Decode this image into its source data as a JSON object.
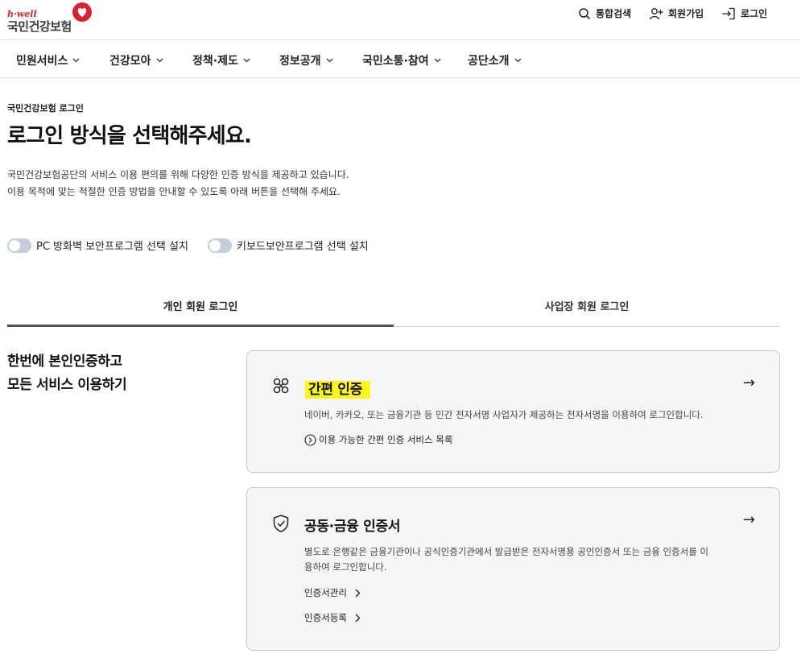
{
  "logo": {
    "brand": "h·well",
    "name": "국민건강보험"
  },
  "utilities": {
    "search": "통합검색",
    "join": "회원가입",
    "login": "로그인"
  },
  "nav": [
    "민원서비스",
    "건강모아",
    "정책·제도",
    "정보공개",
    "국민소통·참여",
    "공단소개"
  ],
  "intro": {
    "eyebrow": "국민건강보험 로그인",
    "title": "로그인 방식을 선택해주세요.",
    "desc_line1": "국민건강보험공단의 서비스 이용 편의를 위해 다양한 인증 방식을 제공하고 있습니다.",
    "desc_line2": "이용 목적에 맞는 적절한 인증 방법을 안내할 수 있도록 아래 버튼을 선택해 주세요."
  },
  "toggles": [
    "PC 방화벽 보안프로그램 선택 설치",
    "키보드보안프로그램 선택 설치"
  ],
  "tabs": {
    "personal": "개인 회원 로그인",
    "business": "사업장 회원 로그인"
  },
  "side_heading": {
    "line1": "한번에 본인인증하고",
    "line2": "모든 서비스 이용하기"
  },
  "cards": {
    "simple": {
      "title": "간편 인증",
      "desc": "네이버, 카카오, 또는 금융기관 등 민간 전자서명 사업자가 제공하는 전자서명을 이용하여 로그인합니다.",
      "link": "이용 가능한 간편 인증 서비스 목록",
      "arrow": "→"
    },
    "cert": {
      "title": "공동·금융 인증서",
      "desc_line1": "별도로 은행같은 금융기관이나 공식인증기관에서 발급받은 전자서명용 공인인증서 또는 금융 인증서를 이",
      "desc_line2": "용하여 로그인합니다.",
      "link1": "인증서관리",
      "link2": "인증서등록",
      "arrow": "→"
    }
  },
  "colors": {
    "brand_red": "#d6232f",
    "highlight": "#fff620",
    "active_tab": "#4b515c"
  }
}
